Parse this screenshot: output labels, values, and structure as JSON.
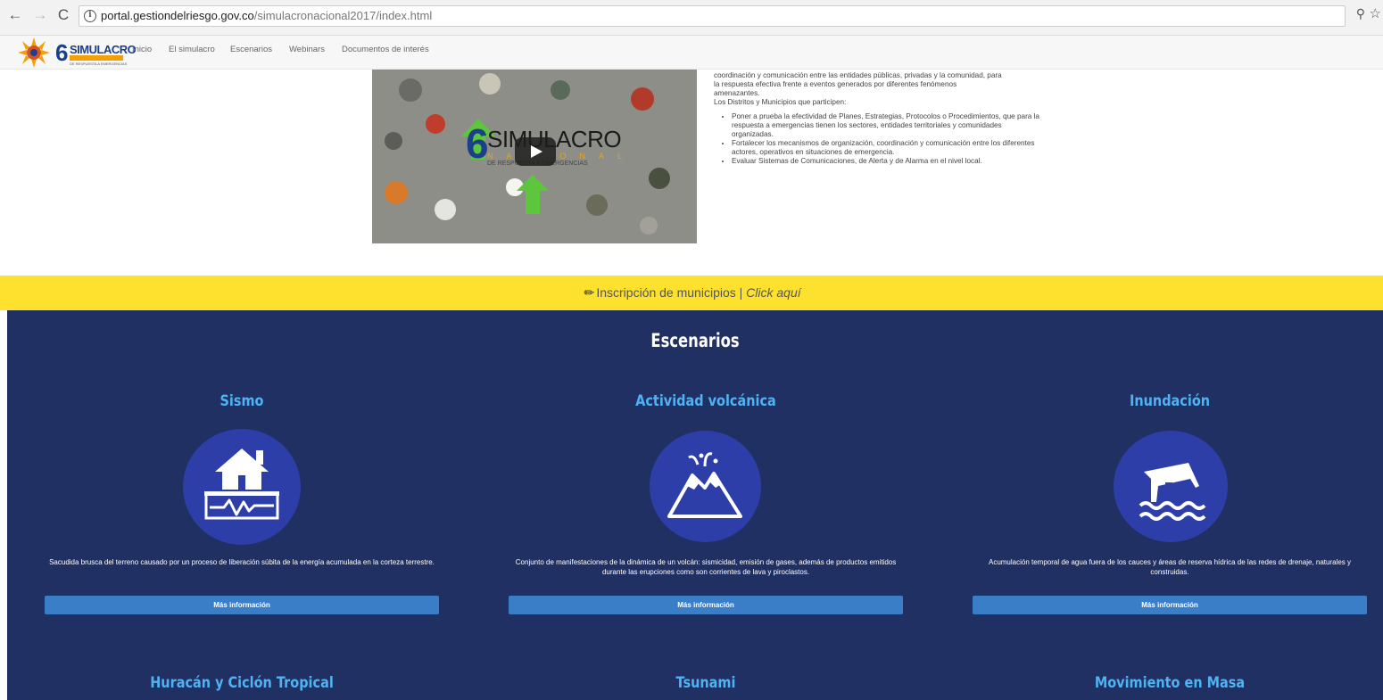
{
  "browser": {
    "url_host": "portal.gestiondelriesgo.gov.co",
    "url_path": "/simulacronacional2017/index.html"
  },
  "nav": {
    "logo_number": "6",
    "logo_word": "SIMULACRO",
    "logo_sub": "DE RESPUESTA A EMERGENCIAS",
    "items": [
      "Inicio",
      "El simulacro",
      "Escenarios",
      "Webinars",
      "Documentos de interés"
    ]
  },
  "video": {
    "number": "6",
    "word": "SIMULACRO",
    "band": "NACIONAL",
    "sub": "DE RESPUESTA A EMERGENCIAS"
  },
  "intro": {
    "lines": [
      "coordinación y comunicación entre las entidades públicas, privadas y la comunidad, para",
      "la respuesta efectiva frente a eventos generados por diferentes fenómenos",
      "amenazantes.",
      "Los Distritos y Municipios que participen:"
    ],
    "bullets": [
      "Poner a prueba la efectividad de Planes, Estrategias, Protocolos o Procedimientos, que para la respuesta a emergencias tienen los sectores, entidades territoriales y comunidades organizadas.",
      "Fortalecer los mecanismos de organización, coordinación y comunicación entre los diferentes actores, operativos en situaciones de emergencia.",
      "Evaluar Sistemas de Comunicaciones, de Alerta y de Alarma en el nivel local."
    ]
  },
  "banner": {
    "text": "Inscripción de municipios | ",
    "link": "Click aquí"
  },
  "escenarios": {
    "title": "Escenarios",
    "cards": [
      {
        "title": "Sismo",
        "icon": "earthquake-house-icon",
        "desc": "Sacudida brusca del terreno causado por un proceso de liberación súbita de la energía acumulada en la corteza terrestre.",
        "button": "Más información"
      },
      {
        "title": "Actividad volcánica",
        "icon": "volcano-icon",
        "desc": "Conjunto de manifestaciones de la dinámica de un volcán: sismicidad, emisión de gases, además de productos emitidos durante las erupciones como son corrientes de lava y piroclastos.",
        "button": "Más información"
      },
      {
        "title": "Inundación",
        "icon": "flood-house-icon",
        "desc": "Acumulación temporal de agua fuera de los cauces y áreas de reserva hídrica de las redes de drenaje, naturales y construidas.",
        "button": "Más información"
      }
    ],
    "next_titles": [
      "Huracán y Ciclón Tropical",
      "Tsunami",
      "Movimiento en Masa"
    ]
  },
  "colors": {
    "banner": "#fde12f",
    "escenarios_bg": "#213062",
    "card_title": "#4fb3f3",
    "icon_circle": "#2d3ea8",
    "button": "#3a7ec8"
  }
}
